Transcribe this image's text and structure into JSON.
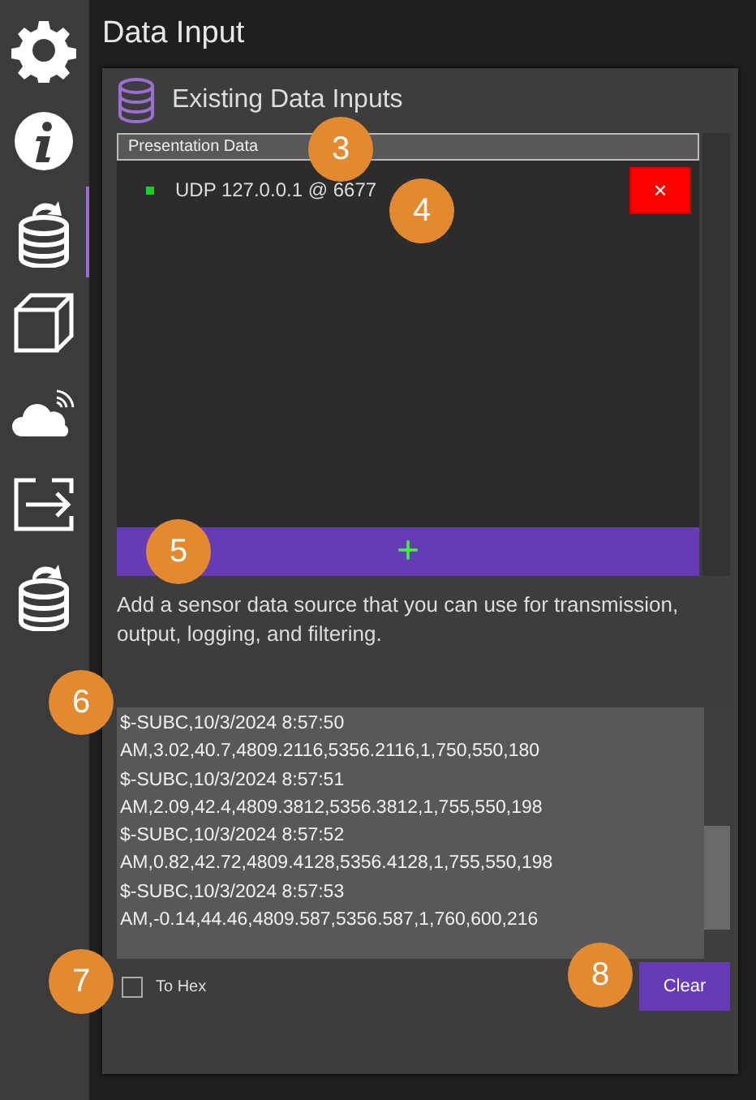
{
  "sidebar": {
    "items": [
      {
        "kind": "gear",
        "selected": false
      },
      {
        "kind": "info",
        "selected": false
      },
      {
        "kind": "db-import",
        "selected": true
      },
      {
        "kind": "cube",
        "selected": false
      },
      {
        "kind": "cloud",
        "selected": false
      },
      {
        "kind": "export",
        "selected": false
      },
      {
        "kind": "db-upload",
        "selected": false
      }
    ]
  },
  "page_title": "Data Input",
  "panel": {
    "title": "Existing Data Inputs",
    "list_header": "Presentation Data",
    "inputs": [
      {
        "label": "UDP 127.0.0.1 @ 6677",
        "color": "#22cc22",
        "delete_label": "×"
      }
    ],
    "add_label": "+",
    "description": "Add a sensor data source that you can use for transmission, output, logging, and filtering.",
    "log_lines": [
      "$-SUBC,10/3/2024 8:57:50",
      "AM,3.02,40.7,4809.2116,5356.2116,1,750,550,180",
      "$-SUBC,10/3/2024 8:57:51",
      "AM,2.09,42.4,4809.3812,5356.3812,1,755,550,198",
      "$-SUBC,10/3/2024 8:57:52",
      "AM,0.82,42.72,4809.4128,5356.4128,1,755,550,198",
      "$-SUBC,10/3/2024 8:57:53",
      "AM,-0.14,44.46,4809.587,5356.587,1,760,600,216"
    ],
    "to_hex": {
      "label": "To Hex",
      "checked": false
    },
    "clear_label": "Clear"
  },
  "callouts": [
    {
      "label": "3"
    },
    {
      "label": "4"
    },
    {
      "label": "5"
    },
    {
      "label": "6"
    },
    {
      "label": "7"
    },
    {
      "label": "8"
    }
  ]
}
